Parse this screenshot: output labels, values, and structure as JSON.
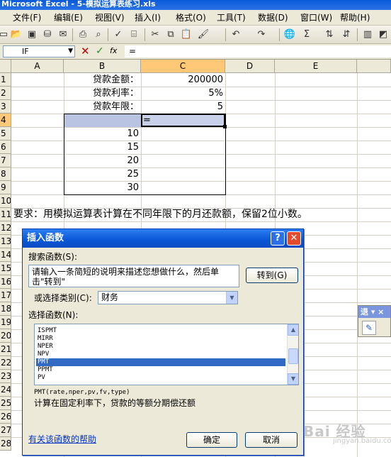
{
  "window": {
    "title": "Microsoft Excel - 5-模拟运算表练习.xls"
  },
  "menu": [
    "文件(F)",
    "编辑(E)",
    "视图(V)",
    "插入(I)",
    "格式(O)",
    "工具(T)",
    "数据(D)",
    "窗口(W)",
    "帮助(H)"
  ],
  "formula_bar": {
    "name_box": "IF",
    "fx": "fx",
    "content": "="
  },
  "columns": [
    "A",
    "B",
    "C",
    "D",
    "E"
  ],
  "rows": [
    "1",
    "2",
    "3",
    "4",
    "5",
    "6",
    "7",
    "8",
    "9",
    "10",
    "11",
    "12",
    "13",
    "14",
    "15",
    "16",
    "17",
    "18",
    "19",
    "20",
    "21",
    "22",
    "23",
    "24",
    "25",
    "26",
    "27",
    "28"
  ],
  "cells": {
    "b1": "贷款金额：",
    "c1": "200000",
    "b2": "贷款利率：",
    "c2": "5%",
    "b3": "贷款年限：",
    "c3": "5",
    "c4": "=",
    "b5": "10",
    "b6": "15",
    "b7": "20",
    "b8": "25",
    "b9": "30",
    "a11": "要求：用模拟运算表计算在不同年限下的月还款额，保留2位小数。"
  },
  "dialog": {
    "title": "插入函数",
    "help_btn": "?",
    "close_btn": "✕",
    "search_label": "搜索函数(S):",
    "search_text": "请输入一条简短的说明来描述您想做什么，然后单击\"转到\"",
    "go_button": "转到(G)",
    "category_label": "或选择类别(C):",
    "category_value": "财务",
    "select_label": "选择函数(N):",
    "functions": [
      "ISPMT",
      "MIRR",
      "NPER",
      "NPV",
      "PMT",
      "PPMT",
      "PV"
    ],
    "selected_function": "PMT",
    "signature": "PMT(rate,nper,pv,fv,type)",
    "description": "计算在固定利率下，贷款的等额分期偿还额",
    "help_link": "有关该函数的帮助",
    "ok_button": "确定",
    "cancel_button": "取消"
  },
  "float_toolbar": {
    "title": "退 ▾ ×"
  },
  "watermark": {
    "text": "Bai 经验",
    "sub": "jingyan.baidu.com"
  }
}
